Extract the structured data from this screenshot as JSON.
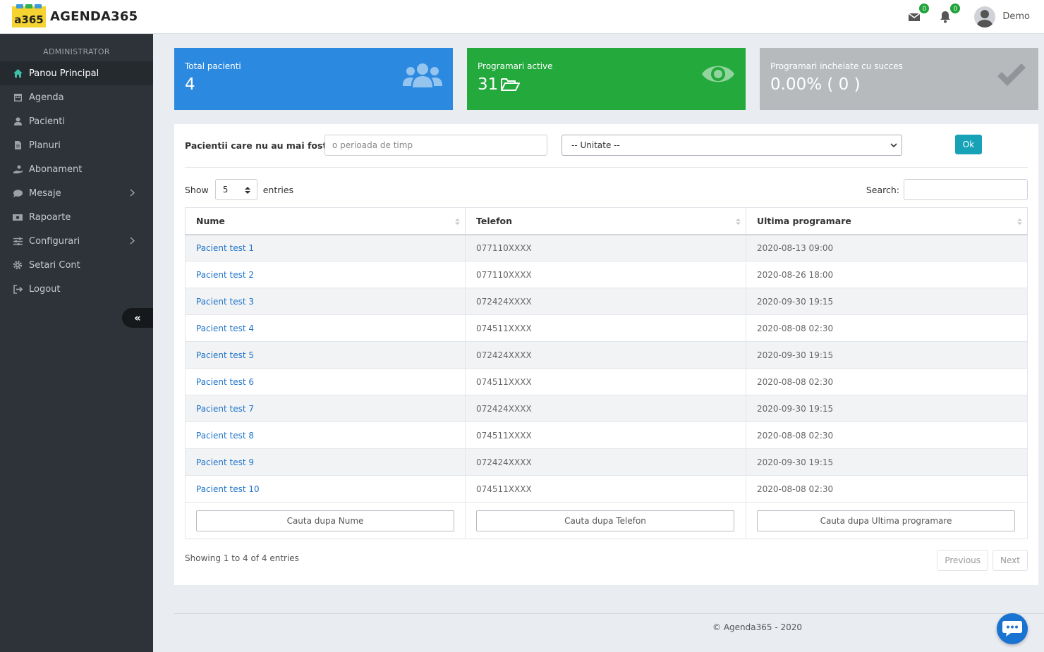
{
  "brand": {
    "badge": "a365",
    "name": "AGENDA365"
  },
  "topbar": {
    "messages_count": "0",
    "notifications_count": "0",
    "user_name": "Demo"
  },
  "sidebar": {
    "section_title": "ADMINISTRATOR",
    "items": [
      {
        "label": "Panou Principal",
        "icon": "home-icon",
        "active": true
      },
      {
        "label": "Agenda",
        "icon": "calendar-icon"
      },
      {
        "label": "Pacienti",
        "icon": "user-nurse-icon"
      },
      {
        "label": "Planuri",
        "icon": "file-icon"
      },
      {
        "label": "Abonament",
        "icon": "hand-holding-icon"
      },
      {
        "label": "Mesaje",
        "icon": "chat-icon",
        "expandable": true
      },
      {
        "label": "Rapoarte",
        "icon": "money-icon"
      },
      {
        "label": "Configurari",
        "icon": "sliders-icon",
        "expandable": true
      },
      {
        "label": "Setari Cont",
        "icon": "gear-icon"
      },
      {
        "label": "Logout",
        "icon": "logout-icon"
      }
    ],
    "collapse_glyph": "«"
  },
  "cards": [
    {
      "label": "Total pacienti",
      "value": "4",
      "color": "#2b8ae0",
      "icon": "users-icon"
    },
    {
      "label": "Programari active",
      "value": "31",
      "color": "#23a93c",
      "icon": "eye-icon",
      "inline_icon": "folder-open-icon"
    },
    {
      "label": "Programari incheiate cu succes",
      "value": "0.00% ( 0 )",
      "color": "#b7babd",
      "icon": "check-icon"
    }
  ],
  "filter": {
    "label": "Pacientii care nu au mai fost de :",
    "period_placeholder": "o perioada de timp",
    "unit_selected": "-- Unitate --",
    "ok_label": "Ok"
  },
  "table_controls": {
    "show_label": "Show",
    "page_length": "5",
    "entries_label": "entries",
    "search_label": "Search:"
  },
  "table": {
    "columns": [
      "Nume",
      "Telefon",
      "Ultima programare"
    ],
    "rows": [
      {
        "name": "Pacient test 1",
        "phone": "077110XXXX",
        "last": "2020-08-13 09:00"
      },
      {
        "name": "Pacient test 2",
        "phone": "077110XXXX",
        "last": "2020-08-26 18:00"
      },
      {
        "name": "Pacient test 3",
        "phone": "072424XXXX",
        "last": "2020-09-30 19:15"
      },
      {
        "name": "Pacient test 4",
        "phone": "074511XXXX",
        "last": "2020-08-08 02:30"
      },
      {
        "name": "Pacient test 5",
        "phone": "072424XXXX",
        "last": "2020-09-30 19:15"
      },
      {
        "name": "Pacient test 6",
        "phone": "074511XXXX",
        "last": "2020-08-08 02:30"
      },
      {
        "name": "Pacient test 7",
        "phone": "072424XXXX",
        "last": "2020-09-30 19:15"
      },
      {
        "name": "Pacient test 8",
        "phone": "074511XXXX",
        "last": "2020-08-08 02:30"
      },
      {
        "name": "Pacient test 9",
        "phone": "072424XXXX",
        "last": "2020-09-30 19:15"
      },
      {
        "name": "Pacient test 10",
        "phone": "074511XXXX",
        "last": "2020-08-08 02:30"
      }
    ],
    "footer_search": [
      "Cauta dupa Nume",
      "Cauta dupa Telefon",
      "Cauta dupa Ultima programare"
    ]
  },
  "pagination": {
    "info": "Showing 1 to 4 of 4 entries",
    "previous": "Previous",
    "next": "Next"
  },
  "footer": {
    "copyright": "© Agenda365 - 2020"
  }
}
